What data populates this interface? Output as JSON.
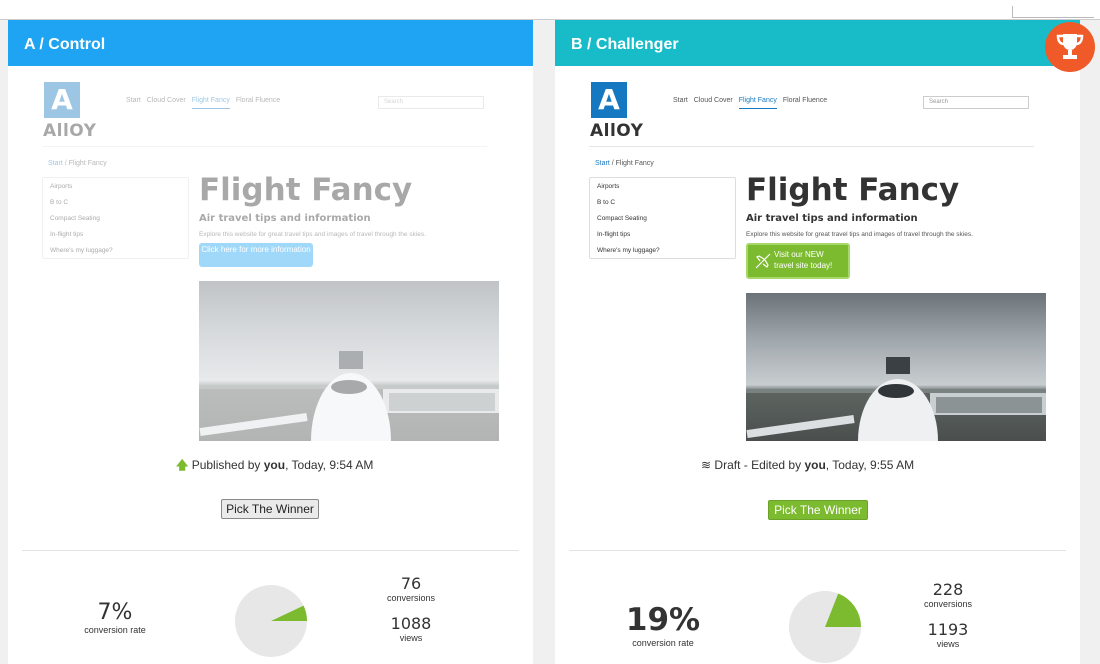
{
  "colors": {
    "panel_a_header": "#1ea4f2",
    "panel_b_header": "#18bcc8",
    "brand_blue": "#1778c2",
    "cta_a": "#9fd6f5",
    "cta_b": "#7cbb2f",
    "winner_green": "#7cbb2f",
    "trophy": "#f05a28",
    "pie_fill": "#7cbb2f"
  },
  "panel_a": {
    "title": "A / Control",
    "site": {
      "logo_letter": "A",
      "logo_text": "AllOY",
      "nav": [
        "Start",
        "Cloud Cover",
        "Flight Fancy",
        "Floral Fluence"
      ],
      "search_placeholder": "Search",
      "breadcrumb": [
        "Start",
        "/",
        "Flight Fancy"
      ],
      "sidebar": [
        "Airports",
        "B to C",
        "Compact Seating",
        "In-flight tips",
        "Where's my luggage?"
      ],
      "heading": "Flight Fancy",
      "subheading": "Air travel tips and information",
      "description": "Explore this website for great travel tips and images of travel through the skies.",
      "cta_label": "Click here for more information"
    },
    "status_icon": "arrow-up-icon",
    "status_prefix": "Published by",
    "status_user": "you",
    "status_suffix": ", Today, 9:54 AM",
    "pick_label": "Pick The Winner",
    "conversion_rate": "7%",
    "conversion_rate_label": "conversion rate",
    "conversion_fraction": 0.07,
    "conversions": "76",
    "conversions_label": "conversions",
    "views": "1088",
    "views_label": "views"
  },
  "panel_b": {
    "title": "B / Challenger",
    "site": {
      "logo_letter": "A",
      "logo_text": "AllOY",
      "nav": [
        "Start",
        "Cloud Cover",
        "Flight Fancy",
        "Floral Fluence"
      ],
      "search_placeholder": "Search",
      "breadcrumb": [
        "Start",
        "/",
        "Flight Fancy"
      ],
      "sidebar": [
        "Airports",
        "B to C",
        "Compact Seating",
        "In-flight tips",
        "Where's my luggage?"
      ],
      "heading": "Flight Fancy",
      "subheading": "Air travel tips and information",
      "description": "Explore this website for great travel tips and images of travel through the skies.",
      "cta_line1": "Visit our NEW",
      "cta_line2": "travel site today!"
    },
    "status_icon": "layers-icon",
    "status_prefix": "Draft - Edited by",
    "status_user": "you",
    "status_suffix": ", Today, 9:55 AM",
    "pick_label": "Pick The Winner",
    "conversion_rate": "19%",
    "conversion_rate_label": "conversion rate",
    "conversion_fraction": 0.19,
    "conversions": "228",
    "conversions_label": "conversions",
    "views": "1193",
    "views_label": "views"
  },
  "winner_icon": "trophy-icon"
}
